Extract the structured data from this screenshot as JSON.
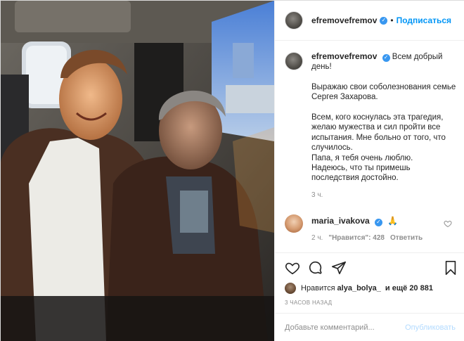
{
  "post": {
    "author": "efremovefremov",
    "follow_label": "Подписаться",
    "separator": "•",
    "verified_glyph": "✓",
    "caption": {
      "greeting": "Всем добрый день!",
      "text": "Выражаю свои соболезнования семье Сергея Захарова.\n\nВсем, кого коснулась эта трагедия, желаю мужества и сил пройти все испытания. Мне больно от того, что случилось.\nПапа, я тебя очень люблю.\nНадеюсь, что ты примешь последствия достойно.",
      "time": "3 ч."
    },
    "comment": {
      "author": "maria_ivakova",
      "emoji": "🙏",
      "time": "2 ч.",
      "likes": "\"Нравится\": 428",
      "reply": "Ответить"
    },
    "likes": {
      "prefix": "Нравится",
      "user": "alya_bolya_",
      "suffix": "и ещё 20 881"
    },
    "posted_ago": "3 ЧАСОВ НАЗАД",
    "add_comment_placeholder": "Добавьте комментарий...",
    "publish_label": "Опубликовать",
    "icons": {
      "like": "heart-icon",
      "comment": "comment-icon",
      "share": "share-icon",
      "save": "bookmark-icon"
    },
    "colors": {
      "link_blue": "#0095f6",
      "verified_blue": "#3897f0",
      "muted": "#8e8e8e"
    }
  }
}
